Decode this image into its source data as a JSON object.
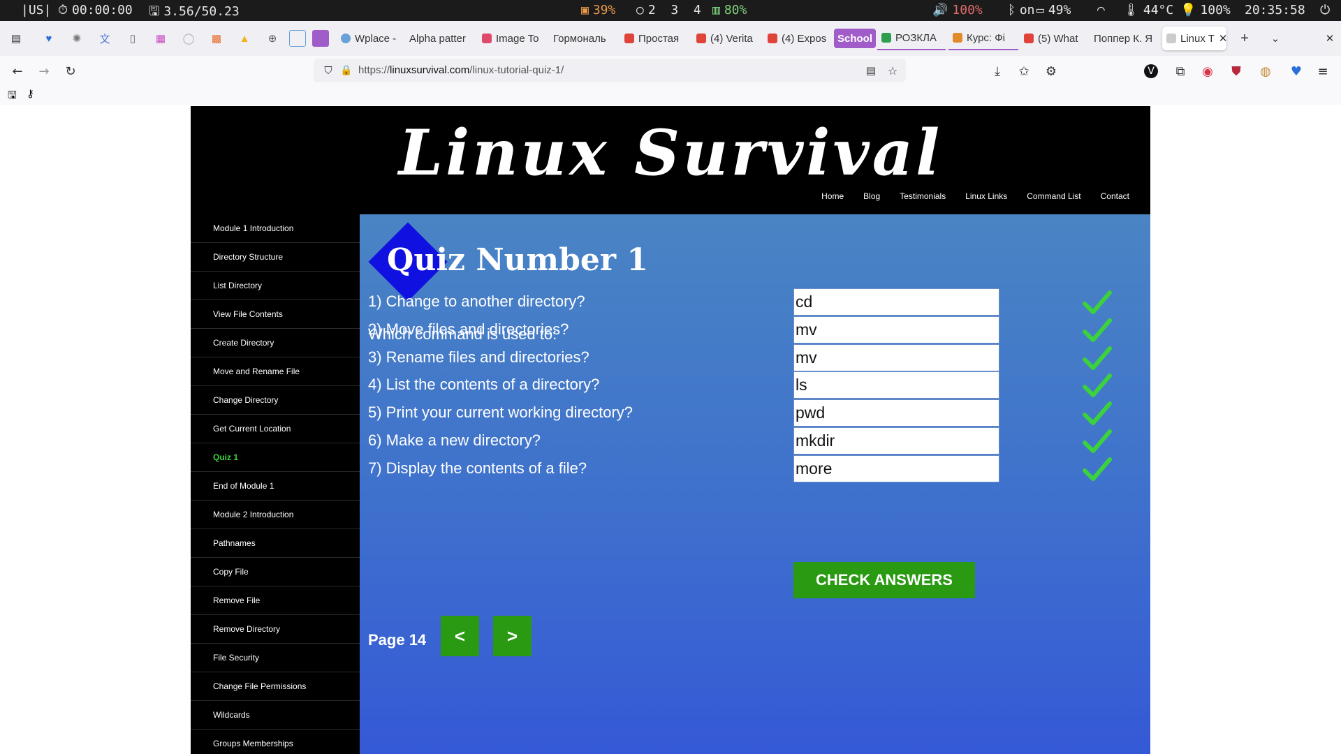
{
  "sysbar": {
    "layout": "|US|",
    "timer": "00:00:00",
    "disk": "3.56/50.23",
    "cpu": "39%",
    "workspaces": [
      "2",
      "3",
      "4"
    ],
    "ram": "80%",
    "volume": "100%",
    "bluetooth": "on",
    "battery": "49%",
    "temperature": "44°C",
    "brightness": "100%",
    "clock": "20:35:58"
  },
  "tabs": [
    {
      "label": "Wplace -",
      "color": "#6aa0d8"
    },
    {
      "label": "Alpha patter",
      "color": ""
    },
    {
      "label": "Image To",
      "color": "#e04a6a"
    },
    {
      "label": "Гормональ",
      "color": ""
    },
    {
      "label": "Простая",
      "color": "#e0433a"
    },
    {
      "label": "(4) Verita",
      "color": "#e0433a"
    },
    {
      "label": "(4) Expos",
      "color": "#e0433a"
    },
    {
      "label": "School",
      "color": "#a05cc9"
    },
    {
      "label": "РОЗКЛА",
      "color": "#2e9f4e"
    },
    {
      "label": "Курс: Фі",
      "color": "#e08a2a"
    },
    {
      "label": "(5) What",
      "color": "#e0433a"
    },
    {
      "label": "Поппер К. Я",
      "color": ""
    },
    {
      "label": "Linux T",
      "color": "#cccccc"
    }
  ],
  "browser": {
    "url_prefix": "https://",
    "url_domain": "linuxsurvival.com",
    "url_path": "/linux-tutorial-quiz-1/"
  },
  "site": {
    "title": "Linux Survival",
    "nav": [
      "Home",
      "Blog",
      "Testimonials",
      "Linux Links",
      "Command List",
      "Contact"
    ]
  },
  "sidebar": {
    "items": [
      "Module 1 Introduction",
      "Directory Structure",
      "List Directory",
      "View File Contents",
      "Create Directory",
      "Move and Rename File",
      "Change Directory",
      "Get Current Location",
      "Quiz 1",
      "End of Module 1",
      "Module 2 Introduction",
      "Pathnames",
      "Copy File",
      "Remove File",
      "Remove Directory",
      "File Security",
      "Change File Permissions",
      "Wildcards",
      "Groups Memberships"
    ],
    "active_index": 8
  },
  "quiz": {
    "title": "Quiz Number 1",
    "intro": "Which command is used to:",
    "questions": [
      {
        "text": "1) Change to another directory?",
        "answer": "cd",
        "correct": true
      },
      {
        "text": "2) Move files and directories?",
        "answer": "mv",
        "correct": true
      },
      {
        "text": "3) Rename files and directories?",
        "answer": "mv",
        "correct": true
      },
      {
        "text": "4) List the contents of a directory?",
        "answer": "ls",
        "correct": true
      },
      {
        "text": "5) Print your current working directory?",
        "answer": "pwd",
        "correct": true
      },
      {
        "text": "6) Make a new directory?",
        "answer": "mkdir",
        "correct": true
      },
      {
        "text": "7) Display the contents of a file?",
        "answer": "more",
        "correct": true
      }
    ],
    "check_button": "CHECK ANSWERS",
    "page_label": "Page 14",
    "prev_label": "<",
    "next_label": ">"
  },
  "colors": {
    "check_green": "#3cd23c",
    "button_green": "#2a9a12",
    "active_side": "#3cd23c"
  }
}
